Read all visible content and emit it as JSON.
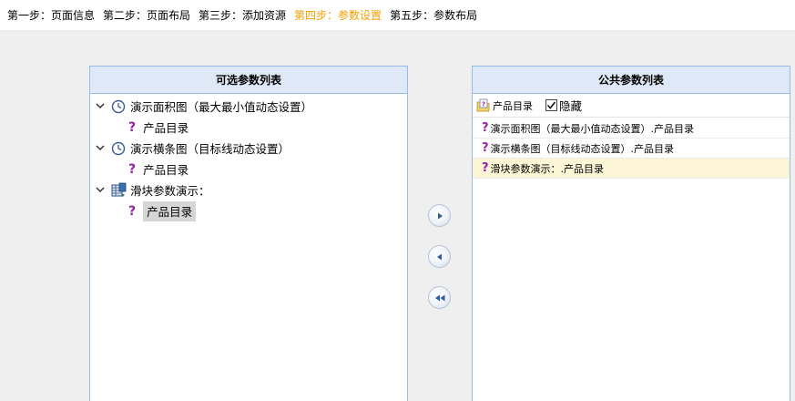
{
  "steps": [
    {
      "label": "第一步：页面信息",
      "active": false
    },
    {
      "label": "第二步：页面布局",
      "active": false
    },
    {
      "label": "第三步：添加资源",
      "active": false
    },
    {
      "label": "第四步：参数设置",
      "active": true
    },
    {
      "label": "第五步：参数布局",
      "active": false
    }
  ],
  "colors": {
    "active_step": "#f5a000",
    "header_bg": "#dfe8f6",
    "panel_border": "#99bbe8",
    "param_icon": "#9b1fa8",
    "selected_row": "#fdf6d6"
  },
  "left_panel": {
    "title": "可选参数列表",
    "tree": [
      {
        "label": "演示面积图（最大最小值动态设置）",
        "icon": "clock-icon",
        "children": [
          {
            "label": "产品目录",
            "icon": "question-icon"
          }
        ]
      },
      {
        "label": "演示横条图（目标线动态设置）",
        "icon": "clock-icon",
        "children": [
          {
            "label": "产品目录",
            "icon": "question-icon",
            "selected": false
          }
        ]
      },
      {
        "label": "滑块参数演示：",
        "icon": "data-table-icon",
        "children": [
          {
            "label": "产品目录",
            "icon": "question-icon",
            "selected": true
          }
        ]
      }
    ]
  },
  "buttons": {
    "add": "arrow-right-icon",
    "remove": "arrow-left-icon",
    "remove_all": "double-arrow-left-icon"
  },
  "right_panel": {
    "title": "公共参数列表",
    "toolbar": {
      "folder_label": "产品目录",
      "hide_label": "隐藏",
      "hide_checked": true
    },
    "items": [
      {
        "label": "演示面积图（最大最小值动态设置）.产品目录",
        "selected": false
      },
      {
        "label": "演示横条图（目标线动态设置）.产品目录",
        "selected": false
      },
      {
        "label": "滑块参数演示：.产品目录",
        "selected": true
      }
    ]
  }
}
